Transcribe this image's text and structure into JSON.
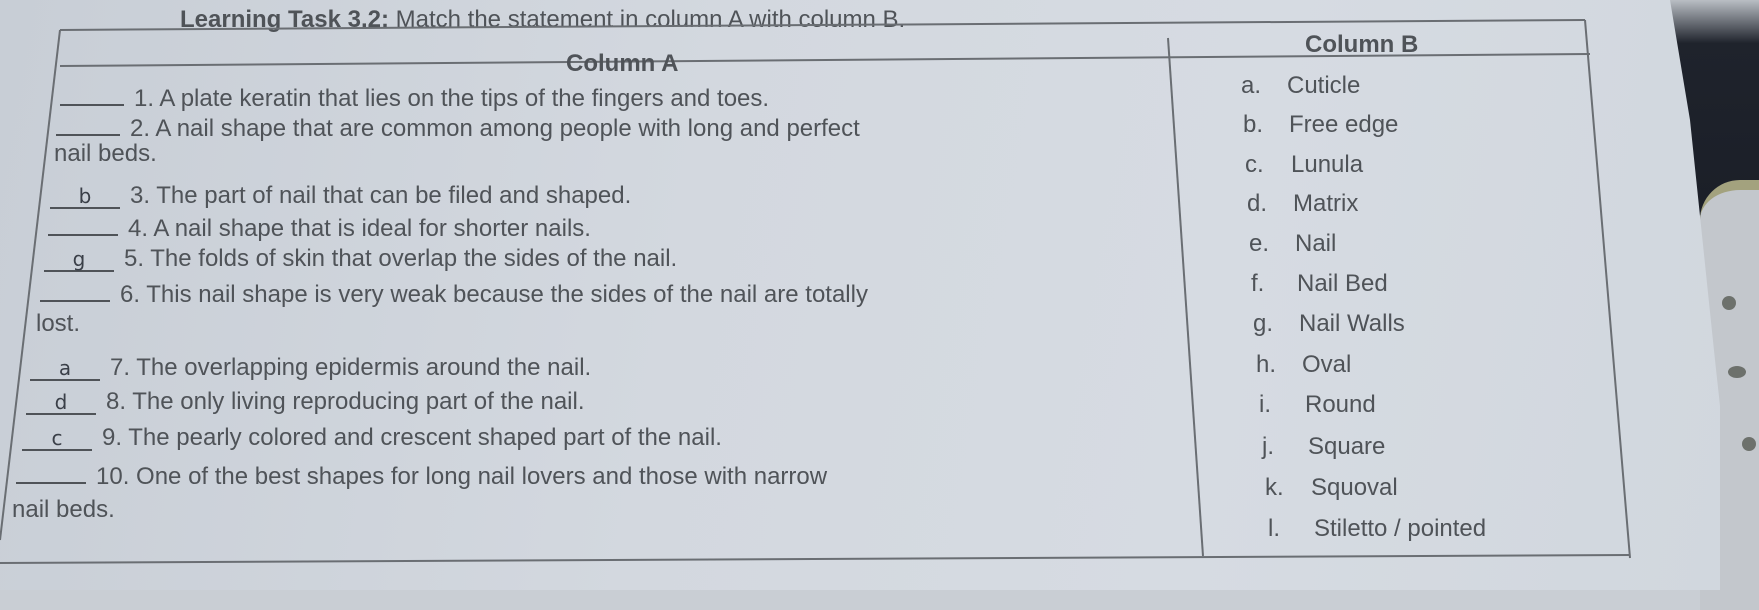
{
  "title": {
    "bold": "Learning Task 3.2:",
    "rest": " Match the statement in column A with column B."
  },
  "column_a": {
    "header": "Column A",
    "items": [
      {
        "answer": "",
        "line1": "1. A plate keratin that lies on the tips of the fingers and toes.",
        "line2": ""
      },
      {
        "answer": "",
        "line1": "2. A nail shape that are common among people with long and perfect",
        "line2": "nail beds."
      },
      {
        "answer": "b",
        "line1": "3. The part of nail that can be filed and shaped.",
        "line2": ""
      },
      {
        "answer": "",
        "line1": "4. A nail shape that is ideal for shorter nails.",
        "line2": ""
      },
      {
        "answer": "g",
        "line1": "5. The folds of skin that overlap the sides of the nail.",
        "line2": ""
      },
      {
        "answer": "",
        "line1": "6. This nail shape is very weak because the sides of the nail are totally",
        "line2": "lost."
      },
      {
        "answer": "a",
        "line1": "7. The overlapping epidermis around the nail.",
        "line2": ""
      },
      {
        "answer": "d",
        "line1": "8. The only living reproducing part of the nail.",
        "line2": ""
      },
      {
        "answer": "c",
        "line1": "9. The pearly colored and crescent shaped part of the nail.",
        "line2": ""
      },
      {
        "answer": "",
        "line1": "10.   One of the best shapes for long nail lovers and those with narrow",
        "line2": "nail beds."
      }
    ]
  },
  "column_b": {
    "header": "Column B",
    "options": [
      {
        "letter": "a.",
        "text": "Cuticle"
      },
      {
        "letter": "b.",
        "text": "Free edge"
      },
      {
        "letter": "c.",
        "text": "Lunula"
      },
      {
        "letter": "d.",
        "text": "Matrix"
      },
      {
        "letter": "e.",
        "text": "Nail"
      },
      {
        "letter": "f.",
        "text": "Nail Bed"
      },
      {
        "letter": "g.",
        "text": "Nail Walls"
      },
      {
        "letter": "h.",
        "text": "Oval"
      },
      {
        "letter": "i.",
        "text": "Round"
      },
      {
        "letter": "j.",
        "text": "Square"
      },
      {
        "letter": "k.",
        "text": "Squoval"
      },
      {
        "letter": "l.",
        "text": "Stiletto / pointed"
      }
    ]
  }
}
